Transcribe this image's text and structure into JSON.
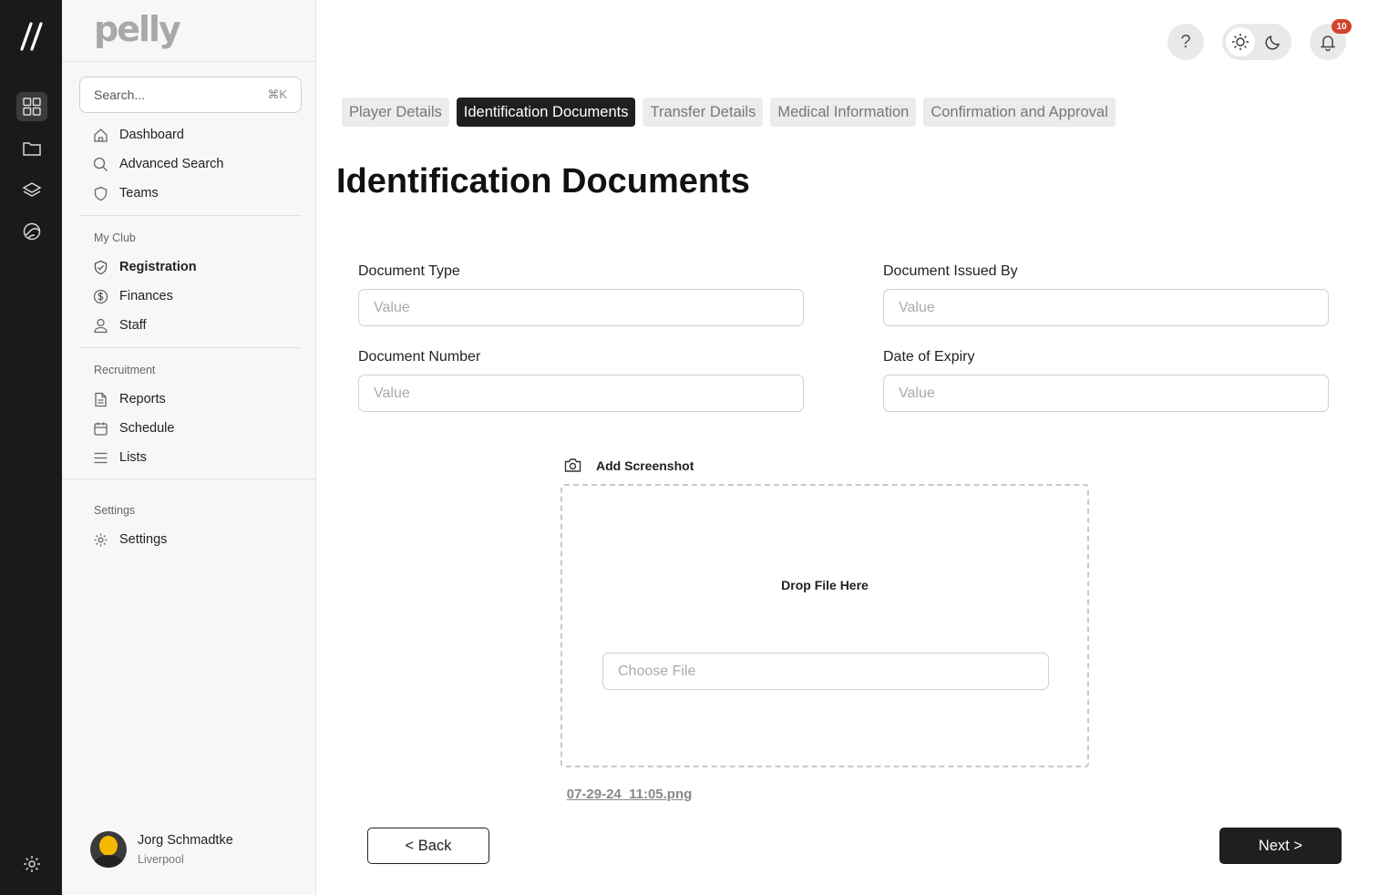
{
  "app": {
    "brand": "pelly"
  },
  "rail": {
    "items": [
      "grid-icon",
      "folder-icon",
      "layers-icon",
      "globe-icon"
    ],
    "bottom": "gear-icon"
  },
  "sidebar": {
    "search": {
      "placeholder": "Search...",
      "shortcut": "⌘K"
    },
    "main_items": [
      {
        "label": "Dashboard",
        "icon": "home-icon"
      },
      {
        "label": "Advanced Search",
        "icon": "search-icon"
      },
      {
        "label": "Teams",
        "icon": "shield-icon"
      }
    ],
    "my_club": {
      "label": "My Club",
      "items": [
        {
          "label": "Registration",
          "icon": "shield-check-icon",
          "active": true
        },
        {
          "label": "Finances",
          "icon": "dollar-icon"
        },
        {
          "label": "Staff",
          "icon": "user-icon"
        }
      ]
    },
    "recruitment": {
      "label": "Recruitment",
      "items": [
        {
          "label": "Reports",
          "icon": "document-icon"
        },
        {
          "label": "Schedule",
          "icon": "calendar-icon"
        },
        {
          "label": "Lists",
          "icon": "list-icon"
        }
      ]
    },
    "settings": {
      "label": "Settings",
      "items": [
        {
          "label": "Settings",
          "icon": "gear-icon"
        }
      ]
    },
    "user": {
      "name": "Jorg Schmadtke",
      "club": "Liverpool"
    }
  },
  "header": {
    "help": "?",
    "notifications": "10"
  },
  "tabs": [
    {
      "label": "Player Details",
      "active": false
    },
    {
      "label": "Identification Documents",
      "active": true
    },
    {
      "label": "Transfer Details",
      "active": false
    },
    {
      "label": "Medical Information",
      "active": false
    },
    {
      "label": "Confirmation and Approval",
      "active": false
    }
  ],
  "page": {
    "title": "Identification Documents",
    "fields": {
      "document_type": {
        "label": "Document Type",
        "placeholder": "Value"
      },
      "document_issued_by": {
        "label": "Document Issued By",
        "placeholder": "Value"
      },
      "document_number": {
        "label": "Document Number",
        "placeholder": "Value"
      },
      "date_of_expiry": {
        "label": "Date of Expiry",
        "placeholder": "Value"
      }
    },
    "upload": {
      "heading": "Add Screenshot",
      "drop_text": "Drop File Here",
      "choose_placeholder": "Choose File",
      "filename": "07-29-24_11:05.png"
    },
    "back_label": "< Back",
    "next_label": "Next >"
  }
}
